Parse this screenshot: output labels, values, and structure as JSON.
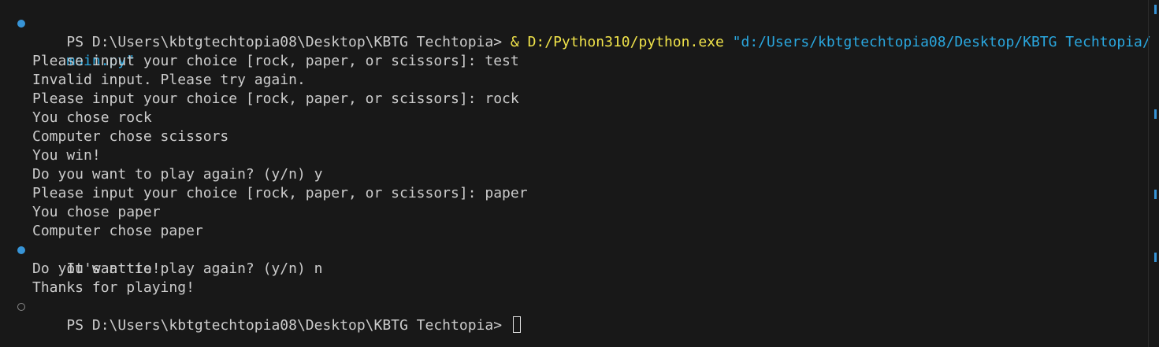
{
  "terminal": {
    "colors": {
      "background": "#181818",
      "text": "#cccccc",
      "command": "#f0e34a",
      "string": "#2aa7df",
      "decoration_success": "#3794d6",
      "decoration_neutral": "#8b8b8b"
    },
    "command": {
      "prompt": "PS D:\\Users\\kbtgtechtopia08\\Desktop\\KBTG Techtopia> ",
      "operator": "& ",
      "executable": "D:/Python310/python.exe",
      "argument_part1": " \"d:/Users/kbtgtechtopia08/Desktop/KBTG Techtopia/",
      "argument_part2": "main.py\""
    },
    "output_lines": [
      "Please input your choice [rock, paper, or scissors]: test",
      "Invalid input. Please try again.",
      "Please input your choice [rock, paper, or scissors]: rock",
      "You chose rock",
      "Computer chose scissors",
      "You win!",
      "Do you want to play again? (y/n) y",
      "Please input your choice [rock, paper, or scissors]: paper",
      "You chose paper",
      "Computer chose paper",
      "It's a tie!",
      "Do you want to play again? (y/n) n",
      "Thanks for playing!"
    ],
    "final_prompt": "PS D:\\Users\\kbtgtechtopia08\\Desktop\\KBTG Techtopia> "
  }
}
